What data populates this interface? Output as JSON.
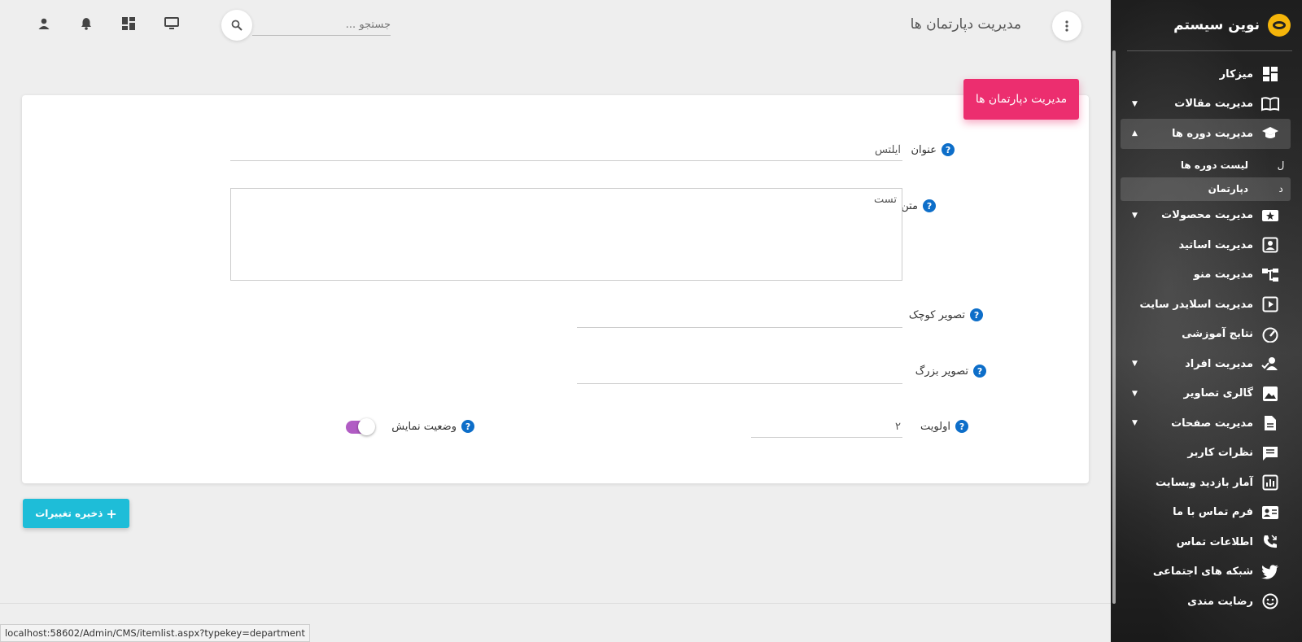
{
  "brand": {
    "title": "نوین سیستم"
  },
  "header": {
    "page_title": "مدیریت دپارتمان ها",
    "search_placeholder": "جستجو ..."
  },
  "sidebar": {
    "items": [
      {
        "label": "میزکار",
        "icon": "dashboard-icon"
      },
      {
        "label": "مدیریت مقالات",
        "icon": "book-icon",
        "caret": "▼"
      },
      {
        "label": "مدیریت دوره ها",
        "icon": "graduation-cap-icon",
        "caret": "▲"
      },
      {
        "label": "مدیریت محصولات",
        "icon": "star-ticket-icon",
        "caret": "▼"
      },
      {
        "label": "مدیریت اساتید",
        "icon": "contact-card-icon"
      },
      {
        "label": "مدیریت منو",
        "icon": "sitemap-icon"
      },
      {
        "label": "مدیریت اسلایدر سایت",
        "icon": "slideshow-icon"
      },
      {
        "label": "نتایج آموزشی",
        "icon": "speedometer-icon"
      },
      {
        "label": "مدیریت افراد",
        "icon": "user-check-icon",
        "caret": "▼"
      },
      {
        "label": "گالری تصاویر",
        "icon": "image-icon",
        "caret": "▼"
      },
      {
        "label": "مدیریت صفحات",
        "icon": "page-icon",
        "caret": "▼"
      },
      {
        "label": "نظرات کاربر",
        "icon": "comment-icon"
      },
      {
        "label": "آمار بازدید وبسایت",
        "icon": "bar-chart-icon"
      },
      {
        "label": "فرم تماس با ما",
        "icon": "contact-mail-icon"
      },
      {
        "label": "اطلاعات تماس",
        "icon": "phone-icon"
      },
      {
        "label": "شبکه های اجتماعی",
        "icon": "twitter-icon"
      },
      {
        "label": "رضایت مندی",
        "icon": "smile-icon"
      }
    ],
    "subitems": [
      {
        "letter": "ل",
        "label": "لیست دوره ها"
      },
      {
        "letter": "د",
        "label": "دپارتمان"
      }
    ]
  },
  "form": {
    "card_title": "مدیریت دپارتمان ها",
    "title_label": "عنوان",
    "title_value": "آیلتس",
    "text_label": "متن",
    "text_value": "تست",
    "thumb_label": "تصویر کوچک",
    "thumb_value": "",
    "large_label": "تصویر بزرگ",
    "large_value": "",
    "priority_label": "اولویت",
    "priority_value": "۲",
    "display_label": "وضعیت نمایش",
    "display_on": true,
    "help_glyph": "?"
  },
  "actions": {
    "save_label": "ذخیره تغییرات",
    "save_icon": "+"
  },
  "status_bar": {
    "url": "localhost:58602/Admin/CMS/itemlist.aspx?typekey=department"
  }
}
